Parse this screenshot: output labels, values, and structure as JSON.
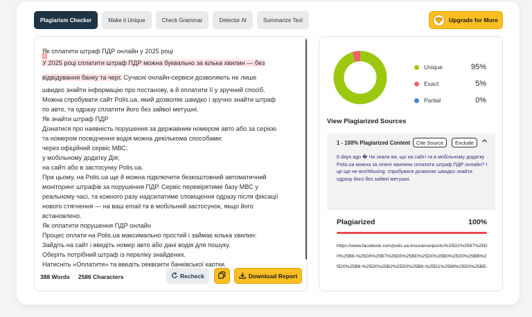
{
  "tabs": [
    {
      "label": "Plagiarism Checker",
      "active": true
    },
    {
      "label": "Make it Unique",
      "active": false
    },
    {
      "label": "Check Grammar",
      "active": false
    },
    {
      "label": "Detector AI",
      "active": false
    },
    {
      "label": "Summarize Text",
      "active": false
    }
  ],
  "upgrade": {
    "label": "Upgrade for More",
    "icon": "sketch-diamond-icon"
  },
  "editor": {
    "marker": "1",
    "lines": [
      {
        "text": "Як сплатити штраф ПДР онлайн у 2025 році",
        "hl": false
      },
      {
        "text": "У 2025 році сплатити штраф ПДР можна буквально за кілька хвилин — без",
        "hl": true
      },
      {
        "text": "відвідування банку та черг.",
        "hl": true,
        "rest": " Сучасні онлайн-сервіси дозволяють не лише"
      },
      {
        "text": "швидко знайти інформацію про постанову, а й оплатити її у зручний спосіб.",
        "hl": false
      },
      {
        "text": "Можна спробувати сайт Polis.ua, який дозволяє швидко і зручно знайти штраф",
        "hl": false
      },
      {
        "text": "по авто, та одразу сплатити його без зайвої метушні.",
        "hl": false
      },
      {
        "text": "Як знайти штраф ПДР",
        "hl": false
      },
      {
        "text": "Дізнатися про наявність порушення за державним номером авто або за серією",
        "hl": false
      },
      {
        "text": "та номером посвідчення водія можна декількома способами:",
        "hl": false
      },
      {
        "text": "через офіційний сервіс МВС;",
        "hl": false
      },
      {
        "text": "у мобільному додатку Дія;",
        "hl": false
      },
      {
        "text": "на сайті або в застосунку Polis.ua.",
        "hl": false
      },
      {
        "text": "При цьому, на Polis.ua ще й можна підключити безкоштовний автоматичний",
        "hl": false
      },
      {
        "text": "моніторинг штрафів за порушення ПДР. Сервіс перевірятиме базу МВС у",
        "hl": false
      },
      {
        "text": "реальному часі, та кожного разу надсилатиме сповіщення одразу після фіксації",
        "hl": false
      },
      {
        "text": "нового стягнення — на ваш email та в мобільний застосунок, якщо його",
        "hl": false
      },
      {
        "text": "встановлено.",
        "hl": false
      },
      {
        "text": "Як оплатити порушення ПДР онлайн",
        "hl": false
      },
      {
        "text": "Процес оплати на Polis.ua максимально простий і займає кілька хвилин:",
        "hl": false
      },
      {
        "text": "Зайдіть на сайт і введіть номер авто або дані водія для пошуку.",
        "hl": false
      },
      {
        "text": "Оберіть потрібний штраф із переліку знайдених.",
        "hl": false
      },
      {
        "text": "Натисніть «Оплатити» та введіть реквізити банківської картки.",
        "hl": false
      }
    ],
    "words": "388 Words",
    "characters": "2586 Characters",
    "recheck_label": "Recheck",
    "download_label": "Download Report"
  },
  "results": {
    "legend": [
      {
        "label": "Unique",
        "value": "95%",
        "color": "#9cc90f",
        "percent": 95
      },
      {
        "label": "Exact",
        "value": "5%",
        "color": "#f0626a",
        "percent": 5
      },
      {
        "label": "Partial",
        "value": "0%",
        "color": "#3f86d6",
        "percent": 0
      }
    ],
    "sources_title": "View Plagiarized Sources",
    "source": {
      "heading": "1 - 100% Plagiarized Content",
      "cite_label": "Cite Source",
      "exclude_label": "Exclude",
      "text": "6 days ago � Чи знали ви, що на сайті та в мобільному додатку Polis.ua можна за лічені хвилини сплатити штраф ПДР онлайн? І це ще не все!Missing: спробувати дозволяє швидко знайти одразу його без зайвої метушні.",
      "plag_label": "Plagiarized",
      "plag_value": "100%",
      "url": "https://www.facebook.com/polis.ua.insurance/posts/%25D1%2587%25D0%25B8-%25D0%25B7%25D0%25BD%25D0%25B0%25D0%25BB%25D0%25B8-%25D0%25B2%25D0%25B8-%25D1%2589%25D0%25BE-"
    }
  }
}
